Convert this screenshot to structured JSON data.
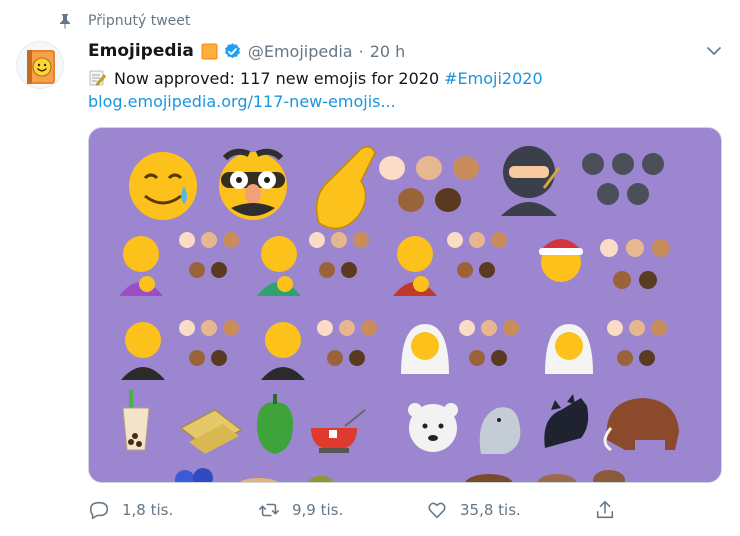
{
  "pinned_label": "Připnutý tweet",
  "author": {
    "name": "Emojipedia",
    "handle": "@Emojipedia",
    "time": "20 h",
    "separator": "·"
  },
  "tweet": {
    "text": "Now approved: 117 new emojis for 2020",
    "hashtag": "#Emoji2020",
    "link": "blog.emojipedia.org/117-new-emojis..."
  },
  "actions": {
    "reply_count": "1,8 tis.",
    "retweet_count": "9,9 tis.",
    "like_count": "35,8 tis."
  },
  "icons": [
    "pin-icon",
    "verified-icon",
    "chevron-down-icon",
    "memo-icon",
    "reply-icon",
    "retweet-icon",
    "like-icon",
    "share-icon"
  ],
  "colors": {
    "link": "#1b95e0",
    "secondary_text": "#657786",
    "media_background": "#9b86cf",
    "verified": "#1da1f2",
    "brand_orange": "#f7931e"
  }
}
